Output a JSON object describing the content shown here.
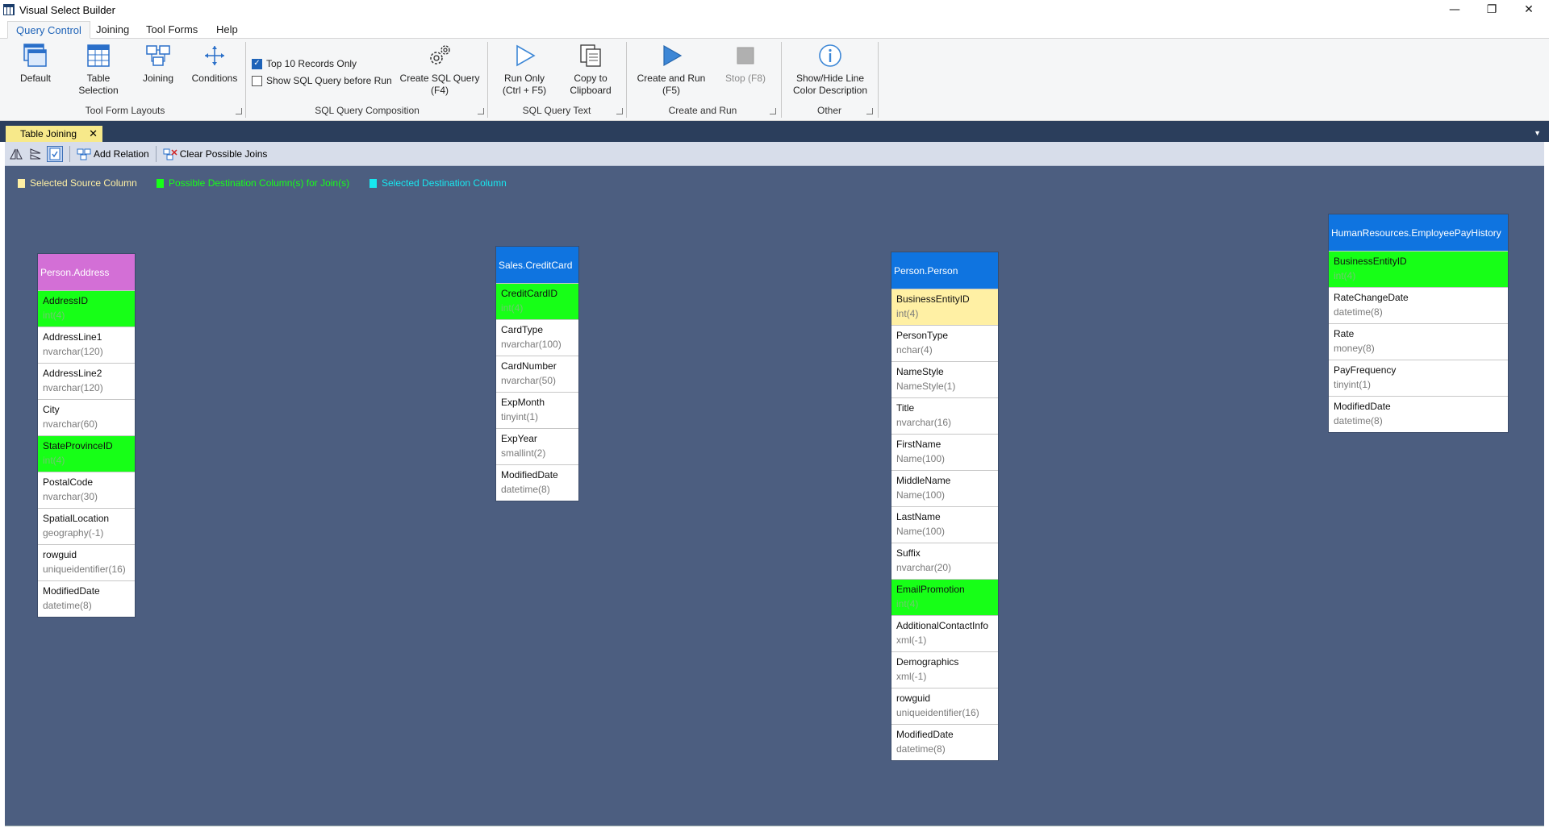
{
  "window": {
    "title": "Visual Select Builder",
    "controls": {
      "minimize": "—",
      "maximize": "❐",
      "close": "✕"
    }
  },
  "menu": {
    "tabs": [
      {
        "label": "Query Control",
        "active": true
      },
      {
        "label": "Joining"
      },
      {
        "label": "Tool Forms"
      },
      {
        "label": "Help"
      }
    ]
  },
  "ribbon": {
    "default_label": "Default",
    "table_selection_label_1": "Table",
    "table_selection_label_2": "Selection",
    "joining_label": "Joining",
    "conditions_label": "Conditions",
    "group_tool_form_layouts": "Tool Form Layouts",
    "top10_label": "Top 10 Records Only",
    "top10_checked": true,
    "show_sql_label": "Show SQL Query before Run",
    "show_sql_checked": false,
    "create_sql_label_1": "Create SQL Query",
    "create_sql_label_2": "(F4)",
    "group_sql_composition": "SQL Query Composition",
    "run_only_label_1": "Run Only",
    "run_only_label_2": "(Ctrl + F5)",
    "copy_label_1": "Copy to",
    "copy_label_2": "Clipboard",
    "group_sql_text": "SQL Query Text",
    "create_run_label_1": "Create and Run",
    "create_run_label_2": "(F5)",
    "stop_label": "Stop (F8)",
    "group_create_run": "Create and Run",
    "show_hide_label_1": "Show/Hide Line",
    "show_hide_label_2": "Color Description",
    "group_other": "Other"
  },
  "document": {
    "tab_label": "Table Joining",
    "tab_close": "✕",
    "dropdown_arrow": "▼"
  },
  "toolstrip": {
    "add_relation_label": "Add Relation",
    "clear_joins_label": "Clear Possible Joins"
  },
  "legend": {
    "source": {
      "label": "Selected Source Column",
      "color": "#fff0a4"
    },
    "possible": {
      "label": "Possible Destination Column(s) for Join(s)",
      "color": "#17ff17"
    },
    "destination": {
      "label": "Selected Destination Column",
      "color": "#17e8f0"
    }
  },
  "colors": {
    "header_magenta": "#d36fd6",
    "header_blue": "#0f74e0",
    "canvas": "#4c5e80",
    "highlight_green": "#17ff17",
    "highlight_yellow": "#fff0a4"
  },
  "tables": {
    "address": {
      "name": "Person.Address",
      "columns": [
        {
          "name": "AddressID",
          "type": "int(4)",
          "hl": "green"
        },
        {
          "name": "AddressLine1",
          "type": "nvarchar(120)"
        },
        {
          "name": "AddressLine2",
          "type": "nvarchar(120)"
        },
        {
          "name": "City",
          "type": "nvarchar(60)"
        },
        {
          "name": "StateProvinceID",
          "type": "int(4)",
          "hl": "green"
        },
        {
          "name": "PostalCode",
          "type": "nvarchar(30)"
        },
        {
          "name": "SpatialLocation",
          "type": "geography(-1)"
        },
        {
          "name": "rowguid",
          "type": "uniqueidentifier(16)"
        },
        {
          "name": "ModifiedDate",
          "type": "datetime(8)"
        }
      ]
    },
    "creditcard": {
      "name": "Sales.CreditCard",
      "columns": [
        {
          "name": "CreditCardID",
          "type": "int(4)",
          "hl": "green"
        },
        {
          "name": "CardType",
          "type": "nvarchar(100)"
        },
        {
          "name": "CardNumber",
          "type": "nvarchar(50)"
        },
        {
          "name": "ExpMonth",
          "type": "tinyint(1)"
        },
        {
          "name": "ExpYear",
          "type": "smallint(2)"
        },
        {
          "name": "ModifiedDate",
          "type": "datetime(8)"
        }
      ]
    },
    "person": {
      "name": "Person.Person",
      "columns": [
        {
          "name": "BusinessEntityID",
          "type": "int(4)",
          "hl": "yellow"
        },
        {
          "name": "PersonType",
          "type": "nchar(4)"
        },
        {
          "name": "NameStyle",
          "type": "NameStyle(1)"
        },
        {
          "name": "Title",
          "type": "nvarchar(16)"
        },
        {
          "name": "FirstName",
          "type": "Name(100)"
        },
        {
          "name": "MiddleName",
          "type": "Name(100)"
        },
        {
          "name": "LastName",
          "type": "Name(100)"
        },
        {
          "name": "Suffix",
          "type": "nvarchar(20)"
        },
        {
          "name": "EmailPromotion",
          "type": "int(4)",
          "hl": "green"
        },
        {
          "name": "AdditionalContactInfo",
          "type": "xml(-1)"
        },
        {
          "name": "Demographics",
          "type": "xml(-1)"
        },
        {
          "name": "rowguid",
          "type": "uniqueidentifier(16)"
        },
        {
          "name": "ModifiedDate",
          "type": "datetime(8)"
        }
      ]
    },
    "payhistory": {
      "name": "HumanResources.EmployeePayHistory",
      "columns": [
        {
          "name": "BusinessEntityID",
          "type": "int(4)",
          "hl": "green"
        },
        {
          "name": "RateChangeDate",
          "type": "datetime(8)"
        },
        {
          "name": "Rate",
          "type": "money(8)"
        },
        {
          "name": "PayFrequency",
          "type": "tinyint(1)"
        },
        {
          "name": "ModifiedDate",
          "type": "datetime(8)"
        }
      ]
    }
  }
}
